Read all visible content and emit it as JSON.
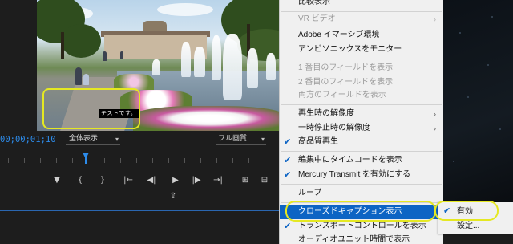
{
  "video": {
    "caption_text": "テストです。"
  },
  "controls": {
    "timecode": "00;00;01;10",
    "zoom_label": "全体表示",
    "resolution_label": "フル画質",
    "icons": [
      "marker-icon",
      "in-point-icon",
      "out-point-icon",
      "go-to-in-icon",
      "step-back-icon",
      "play-icon",
      "step-forward-icon",
      "go-to-out-icon",
      "insert-icon",
      "overwrite-icon",
      "export-frame-icon"
    ]
  },
  "menu": {
    "items": [
      {
        "label": "比較表示",
        "checked": false,
        "disabled": false,
        "submenu": false
      },
      {
        "label": "VR ビデオ",
        "checked": false,
        "disabled": true,
        "submenu": true
      },
      {
        "label": "Adobe イマーシブ環境",
        "checked": false,
        "disabled": false,
        "submenu": false
      },
      {
        "label": "アンビソニックスをモニター",
        "checked": false,
        "disabled": false,
        "submenu": false
      },
      {
        "label": "1 番目のフィールドを表示",
        "checked": false,
        "disabled": true,
        "submenu": false
      },
      {
        "label": "2 番目のフィールドを表示",
        "checked": false,
        "disabled": true,
        "submenu": false
      },
      {
        "label": "両方のフィールドを表示",
        "checked": false,
        "disabled": true,
        "submenu": false
      },
      {
        "label": "再生時の解像度",
        "checked": false,
        "disabled": false,
        "submenu": true
      },
      {
        "label": "一時停止時の解像度",
        "checked": false,
        "disabled": false,
        "submenu": true
      },
      {
        "label": "高品質再生",
        "checked": true,
        "disabled": false,
        "submenu": false
      },
      {
        "label": "編集中にタイムコードを表示",
        "checked": true,
        "disabled": false,
        "submenu": false
      },
      {
        "label": "Mercury Transmit を有効にする",
        "checked": true,
        "disabled": false,
        "submenu": false
      },
      {
        "label": "ループ",
        "checked": false,
        "disabled": false,
        "submenu": false
      },
      {
        "label": "クローズドキャプション表示",
        "checked": false,
        "disabled": false,
        "submenu": true,
        "highlight": true
      },
      {
        "label": "トランスポートコントロールを表示",
        "checked": true,
        "disabled": false,
        "submenu": false
      },
      {
        "label": "オーディオユニット時間で表示",
        "checked": false,
        "disabled": false,
        "submenu": false
      }
    ]
  },
  "submenu": {
    "items": [
      {
        "label": "有効",
        "checked": true
      },
      {
        "label": "設定...",
        "checked": false
      }
    ]
  },
  "colors": {
    "accent": "#0d64c4",
    "timecode": "#2d8ceb",
    "annotation": "#e5e822"
  }
}
